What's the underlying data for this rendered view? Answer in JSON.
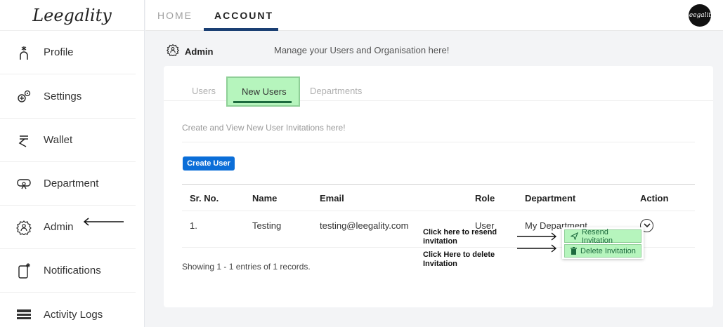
{
  "app": {
    "logo_text": "Leegality",
    "avatar_text": "Leegality"
  },
  "topbar": {
    "tabs": [
      {
        "label": "HOME"
      },
      {
        "label": "ACCOUNT"
      }
    ]
  },
  "sidebar": {
    "items": [
      {
        "label": "Profile",
        "icon": "profile-icon"
      },
      {
        "label": "Settings",
        "icon": "settings-icon"
      },
      {
        "label": "Wallet",
        "icon": "rupee-icon"
      },
      {
        "label": "Department",
        "icon": "department-icon"
      },
      {
        "label": "Admin",
        "icon": "admin-icon"
      },
      {
        "label": "Notifications",
        "icon": "notification-icon"
      },
      {
        "label": "Activity Logs",
        "icon": "activity-logs-icon"
      }
    ]
  },
  "page": {
    "title": "Admin",
    "subtitle": "Manage your Users and Organisation here!"
  },
  "card": {
    "tabs": [
      {
        "label": "Users"
      },
      {
        "label": "New Users"
      },
      {
        "label": "Departments"
      }
    ],
    "description": "Create and View New User Invitations here!",
    "create_button": "Create User",
    "table": {
      "headers": [
        "Sr. No.",
        "Name",
        "Email",
        "Role",
        "Department",
        "Action"
      ],
      "rows": [
        {
          "sr": "1.",
          "name": "Testing",
          "email": "testing@leegality.com",
          "role": "User",
          "department": "My Department"
        }
      ]
    },
    "showing": "Showing 1 - 1 entries of 1 records."
  },
  "annotations": {
    "resend": "Click here to resend invitation",
    "delete": "Click Here to delete Invitation"
  },
  "dropdown": {
    "resend": "Resend Invitation",
    "delete": "Delete Invitation"
  },
  "colors": {
    "primary": "#0b6ed8",
    "highlight": "#b6f5bd",
    "accent_dark": "#1a3f73"
  }
}
